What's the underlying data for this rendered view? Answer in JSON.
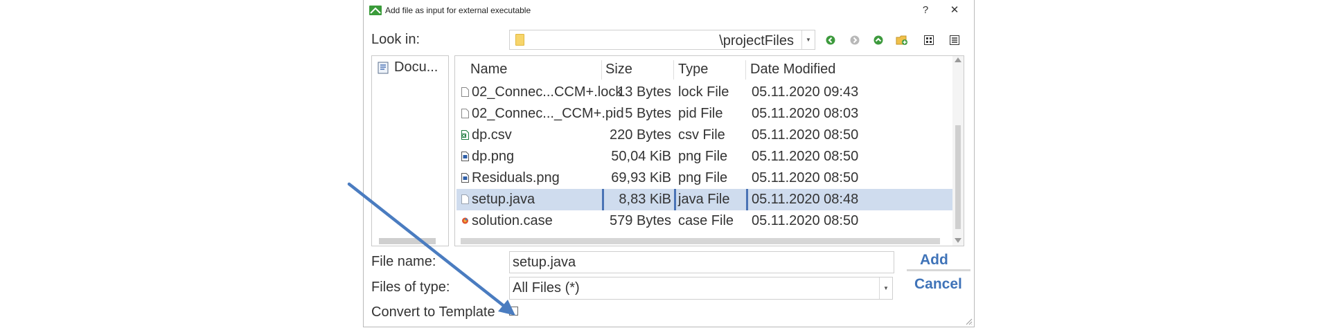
{
  "window": {
    "title": "Add file as input for external executable",
    "help_label": "?",
    "close_label": "✕"
  },
  "lookin": {
    "label": "Look in:",
    "value": "\\projectFiles"
  },
  "toolbar": {
    "icons": [
      "back-icon",
      "forward-icon",
      "up-folder-icon",
      "new-folder-icon",
      "list-view-icon",
      "details-view-icon"
    ]
  },
  "places": {
    "items": [
      {
        "label": "Docu...",
        "icon": "documents-icon"
      }
    ]
  },
  "files": {
    "columns": [
      "Name",
      "Size",
      "Type",
      "Date Modified"
    ],
    "rows": [
      {
        "name": "02_Connec...CCM+.lock",
        "size": "13 Bytes",
        "type": "lock File",
        "date": "05.11.2020 09:43",
        "icon": "file-icon"
      },
      {
        "name": "02_Connec..._CCM+.pid",
        "size": "5 Bytes",
        "type": "pid File",
        "date": "05.11.2020 08:03",
        "icon": "file-icon"
      },
      {
        "name": "dp.csv",
        "size": "220 Bytes",
        "type": "csv File",
        "date": "05.11.2020 08:50",
        "icon": "csv-icon"
      },
      {
        "name": "dp.png",
        "size": "50,04 KiB",
        "type": "png File",
        "date": "05.11.2020 08:50",
        "icon": "image-icon"
      },
      {
        "name": "Residuals.png",
        "size": "69,93 KiB",
        "type": "png File",
        "date": "05.11.2020 08:50",
        "icon": "image-icon"
      },
      {
        "name": "setup.java",
        "size": "8,83 KiB",
        "type": "java File",
        "date": "05.11.2020 08:48",
        "icon": "java-file-icon",
        "selected": true
      },
      {
        "name": "solution.case",
        "size": "579 Bytes",
        "type": "case File",
        "date": "05.11.2020 08:50",
        "icon": "case-file-icon"
      }
    ]
  },
  "filename": {
    "label": "File name:",
    "value": "setup.java"
  },
  "filetype": {
    "label": "Files of type:",
    "value": "All Files (*)"
  },
  "template": {
    "label": "Convert to Template",
    "checked": false
  },
  "buttons": {
    "add_label": "Add",
    "cancel_label": "Cancel"
  },
  "colors": {
    "accent": "#3f73b8",
    "selection": "#cfdcee",
    "annotation_arrow": "#4a7cc0"
  }
}
